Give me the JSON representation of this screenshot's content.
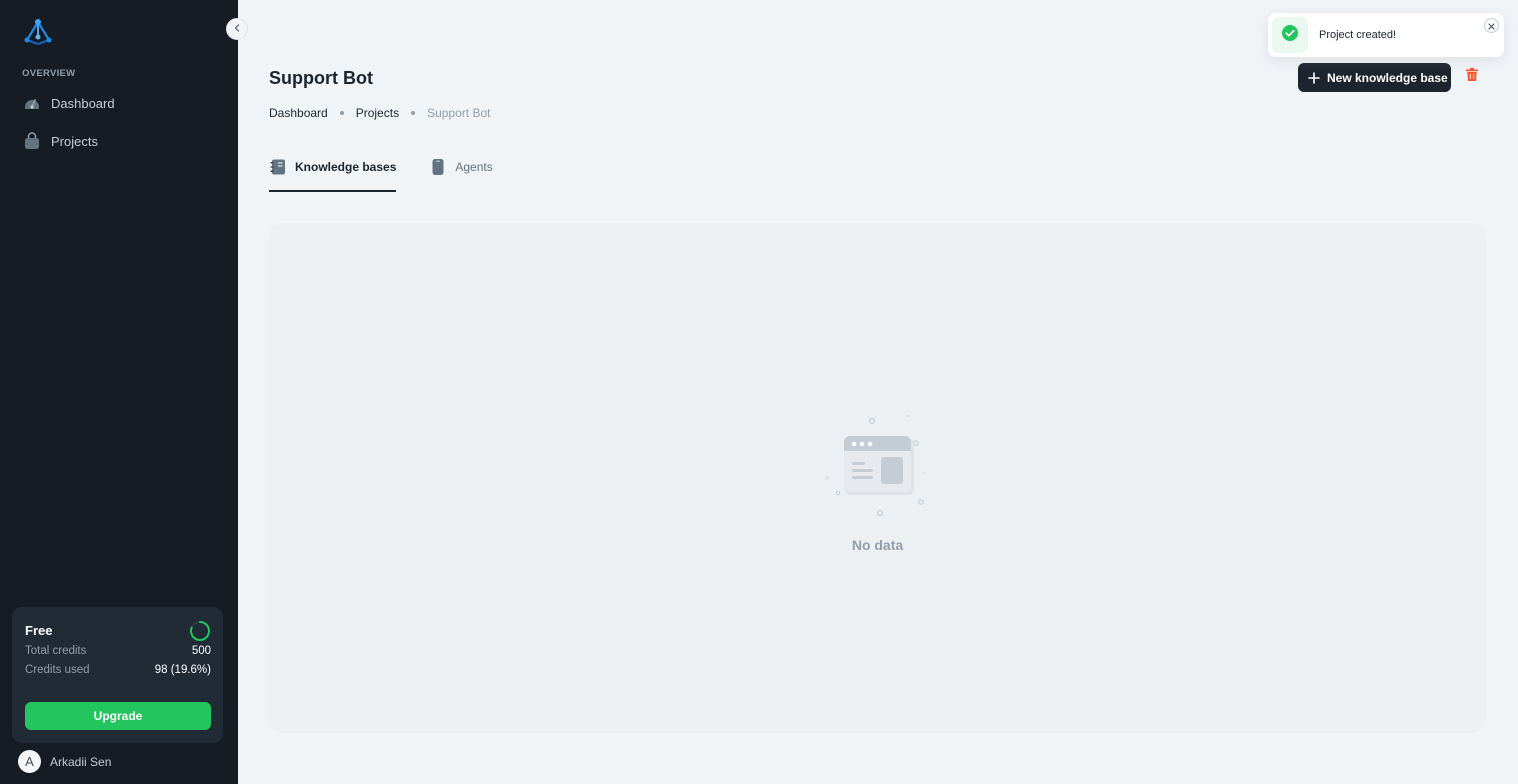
{
  "sidebar": {
    "section_label": "OVERVIEW",
    "items": [
      {
        "label": "Dashboard",
        "icon": "dashboard-icon"
      },
      {
        "label": "Projects",
        "icon": "bag-icon"
      }
    ],
    "plan": {
      "name": "Free",
      "total_credits_label": "Total credits",
      "total_credits_value": "500",
      "credits_used_label": "Credits used",
      "credits_used_value": "98 (19.6%)",
      "credits_used_fraction": 0.196,
      "upgrade_label": "Upgrade"
    },
    "user": {
      "initial": "A",
      "name": "Arkadii Sen"
    }
  },
  "header": {
    "title": "Support Bot",
    "breadcrumb": [
      "Dashboard",
      "Projects",
      "Support Bot"
    ],
    "new_button_label": "New knowledge base"
  },
  "tabs": [
    {
      "label": "Knowledge bases",
      "icon": "notebook-icon",
      "active": true
    },
    {
      "label": "Agents",
      "icon": "phone-icon",
      "active": false
    }
  ],
  "empty_state": {
    "text": "No data"
  },
  "toast": {
    "message": "Project created!"
  },
  "colors": {
    "sidebar_bg": "#161c24",
    "accent_green": "#22c55e",
    "danger_red": "#ff5630",
    "primary_dark": "#1c252e"
  }
}
